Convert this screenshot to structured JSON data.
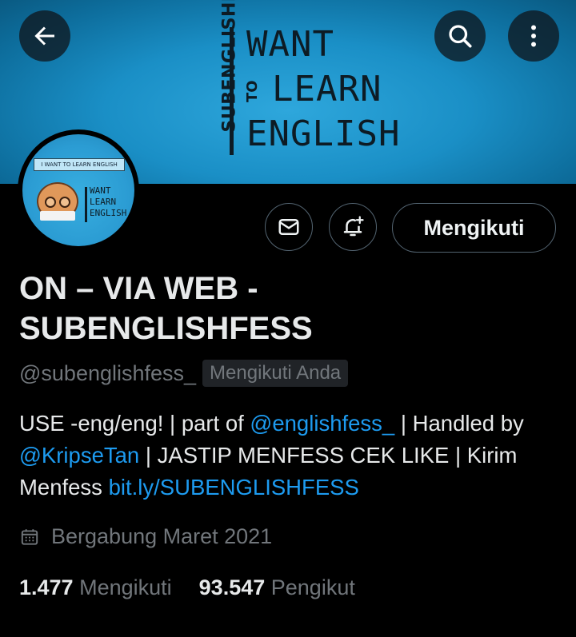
{
  "banner": {
    "vertical_text": "SUBENGLISHFESS",
    "line1": "WANT",
    "to": "TO",
    "line2": "LEARN",
    "line3": "ENGLISH"
  },
  "avatar": {
    "bubble_text": "I WANT TO LEARN ENGLISH",
    "lines": [
      "WANT",
      "LEARN",
      "ENGLISH"
    ]
  },
  "profile": {
    "name": "ON – VIA WEB - SUBENGLISHFESS",
    "handle": "@subenglishfess_",
    "follows_you_badge": "Mengikuti Anda",
    "bio": {
      "part1": "USE -eng/eng! | part of ",
      "mention1": "@englishfess_",
      "part2": " | Handled by ",
      "mention2": "@KripseTan",
      "part3": " | JASTIP MENFESS CEK LIKE | Kirim Menfess ",
      "link": "bit.ly/SUBENGLISHFESS"
    },
    "joined": "Bergabung Maret 2021",
    "following_count": "1.477",
    "following_label": "Mengikuti",
    "followers_count": "93.547",
    "followers_label": "Pengikut"
  },
  "actions": {
    "follow_label": "Mengikuti"
  },
  "icons": [
    "back-arrow-icon",
    "search-icon",
    "more-vertical-icon",
    "mail-icon",
    "bell-plus-icon",
    "calendar-icon"
  ],
  "colors": {
    "accent": "#1d9bf0",
    "muted": "#71767b",
    "background": "#000000",
    "banner": "#1a8fc6"
  }
}
